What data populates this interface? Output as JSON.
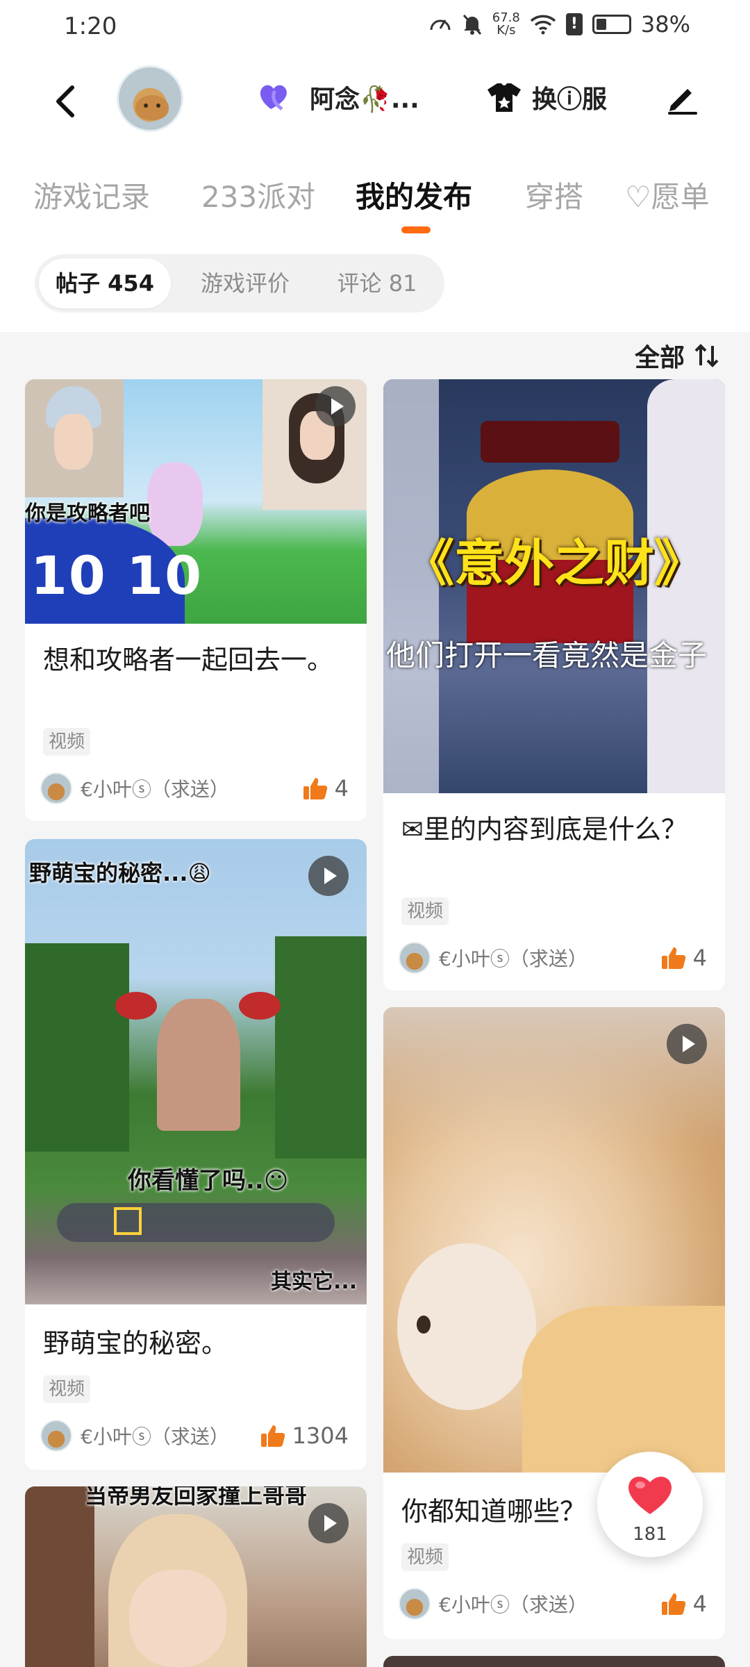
{
  "status_bar": {
    "time": "1:20",
    "net_speed_value": "67.8",
    "net_speed_unit": "K/s",
    "battery": "38%"
  },
  "header": {
    "title": "阿念🥀...",
    "outfit_label": "换ⓘ服"
  },
  "tabs": [
    {
      "label": "游戏记录",
      "active": false
    },
    {
      "label": "233派对",
      "active": false
    },
    {
      "label": "我的发布",
      "active": true
    },
    {
      "label": "穿搭",
      "active": false
    },
    {
      "label": "♡愿单",
      "active": false
    }
  ],
  "segments": [
    {
      "label": "帖子 454",
      "active": true
    },
    {
      "label": "游戏评价",
      "active": false
    },
    {
      "label": "评论 81",
      "active": false
    }
  ],
  "sort_label": "全部",
  "posts": [
    {
      "title": "想和攻略者一起回去一。",
      "tag": "视频",
      "author": "€小叶ⓢ（求送）",
      "likes": "4",
      "overlay": "你是攻略者吧",
      "overlay2": "10 10"
    },
    {
      "title": "✉里的内容到底是什么？",
      "tag": "视频",
      "author": "€小叶ⓢ（求送）",
      "likes": "4",
      "overlay": "《意外之财》",
      "overlay2": "他们打开一看竟然是金子"
    },
    {
      "title": "野萌宝的秘密。",
      "tag": "视频",
      "author": "€小叶ⓢ（求送）",
      "likes": "1304",
      "overlay": "野萌宝的秘密...😩",
      "overlay2": "你看懂了吗..😶",
      "overlay3": "其实它..."
    },
    {
      "title": "你都知道哪些？",
      "tag": "视频",
      "author": "€小叶ⓢ（求送）",
      "likes": "4"
    },
    {
      "overlay": "当帝男友回家撞上哥哥"
    }
  ],
  "floating_like": {
    "count": "181"
  },
  "colors": {
    "accent": "#ff6a13",
    "heart": "#f23a4f",
    "purple": "#7a5cf0"
  }
}
